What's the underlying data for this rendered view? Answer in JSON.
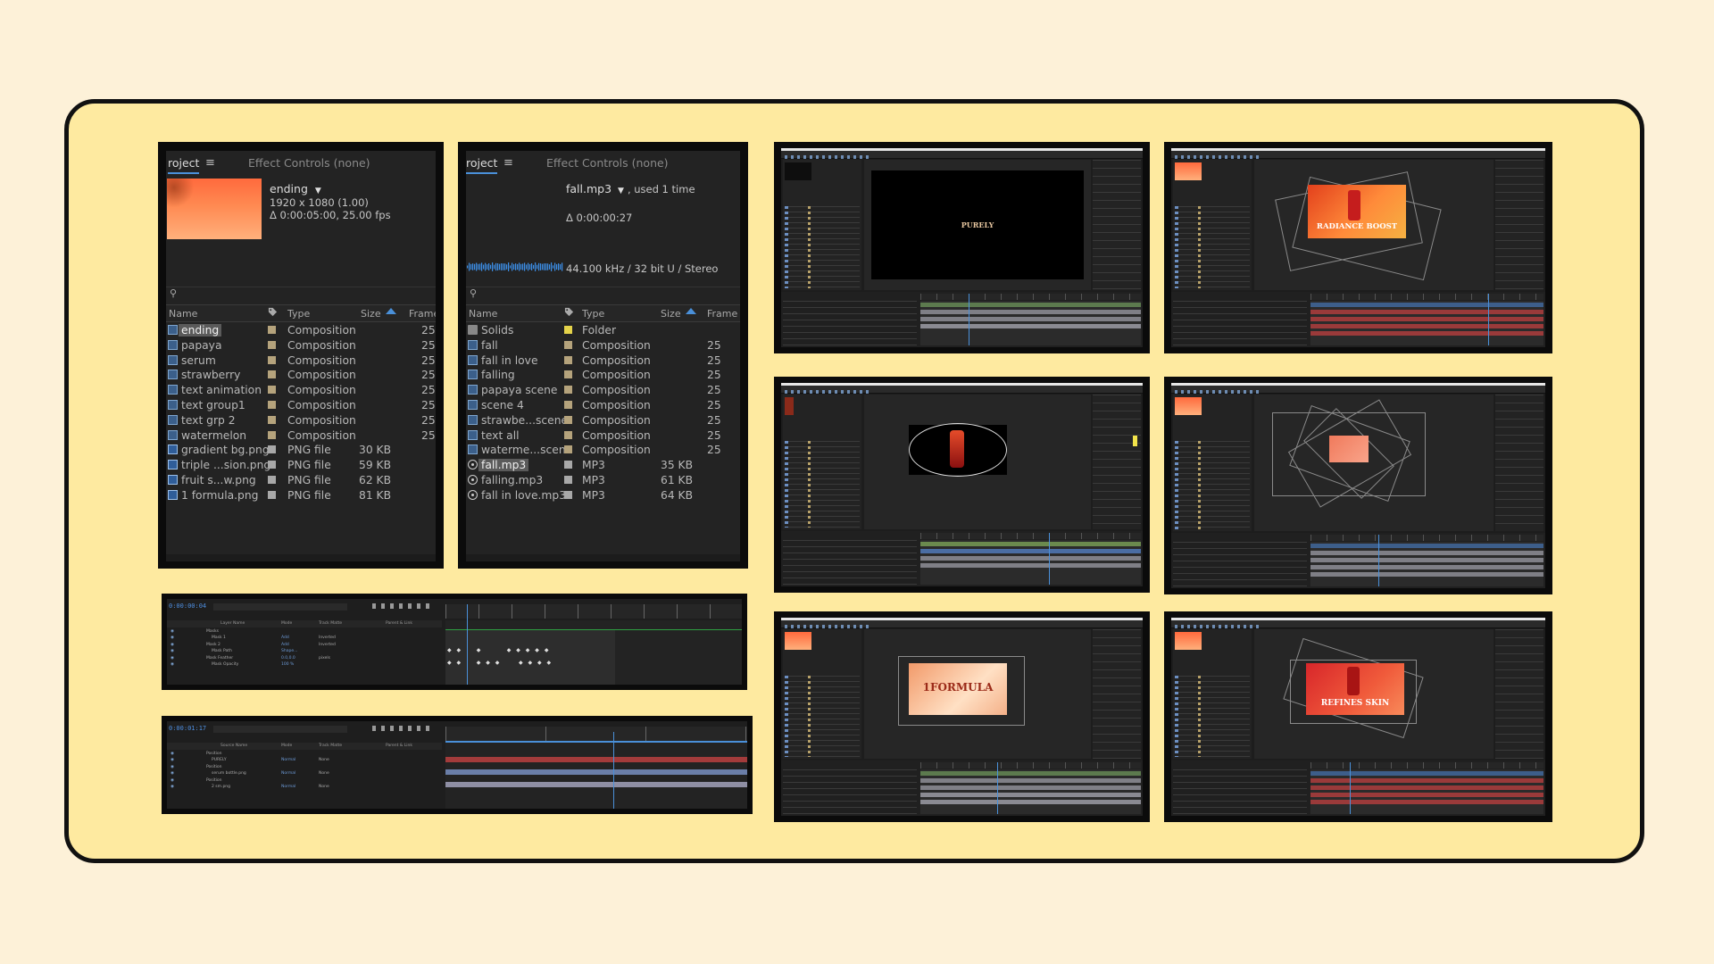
{
  "colors": {
    "background": "#fdf1d8",
    "board": "#feeaa0",
    "accent": "#4a90d9",
    "panel": "#232323"
  },
  "project1": {
    "tab_project": "roject",
    "tab_effect": "Effect Controls (none)",
    "selected_name": "ending",
    "resolution": "1920 x 1080 (1.00)",
    "duration": "Δ 0:00:05:00, 25.00 fps",
    "columns": {
      "name": "Name",
      "type": "Type",
      "size": "Size",
      "frame": "Frame"
    },
    "rows": [
      {
        "name": "ending",
        "type": "Composition",
        "size": "",
        "frame": "25"
      },
      {
        "name": "papaya",
        "type": "Composition",
        "size": "",
        "frame": "25"
      },
      {
        "name": "serum",
        "type": "Composition",
        "size": "",
        "frame": "25"
      },
      {
        "name": "strawberry",
        "type": "Composition",
        "size": "",
        "frame": "25"
      },
      {
        "name": "text animation",
        "type": "Composition",
        "size": "",
        "frame": "25"
      },
      {
        "name": "text group1",
        "type": "Composition",
        "size": "",
        "frame": "25"
      },
      {
        "name": "text grp 2",
        "type": "Composition",
        "size": "",
        "frame": "25"
      },
      {
        "name": "watermelon",
        "type": "Composition",
        "size": "",
        "frame": "25"
      },
      {
        "name": "gradient bg.png",
        "type": "PNG file",
        "size": "30 KB",
        "frame": ""
      },
      {
        "name": "triple ...sion.png",
        "type": "PNG file",
        "size": "59 KB",
        "frame": ""
      },
      {
        "name": "fruit s...w.png",
        "type": "PNG file",
        "size": "62 KB",
        "frame": ""
      },
      {
        "name": "1 formula.png",
        "type": "PNG file",
        "size": "81 KB",
        "frame": ""
      }
    ]
  },
  "project2": {
    "tab_project": "roject",
    "tab_effect": "Effect Controls (none)",
    "selected_name": "fall.mp3",
    "used": ", used 1 time",
    "duration": "Δ 0:00:00:27",
    "audio_info": "44.100 kHz / 32 bit U / Stereo",
    "columns": {
      "name": "Name",
      "type": "Type",
      "size": "Size",
      "frame": "Frame R"
    },
    "rows": [
      {
        "name": "Solids",
        "type": "Folder",
        "size": "",
        "frame": ""
      },
      {
        "name": "fall",
        "type": "Composition",
        "size": "",
        "frame": "25"
      },
      {
        "name": "fall in love",
        "type": "Composition",
        "size": "",
        "frame": "25"
      },
      {
        "name": "falling",
        "type": "Composition",
        "size": "",
        "frame": "25"
      },
      {
        "name": "papaya scene",
        "type": "Composition",
        "size": "",
        "frame": "25"
      },
      {
        "name": "scene 4",
        "type": "Composition",
        "size": "",
        "frame": "25"
      },
      {
        "name": "strawbe...scene",
        "type": "Composition",
        "size": "",
        "frame": "25"
      },
      {
        "name": "text all",
        "type": "Composition",
        "size": "",
        "frame": "25"
      },
      {
        "name": "waterme...scene",
        "type": "Composition",
        "size": "",
        "frame": "25"
      },
      {
        "name": "fall.mp3",
        "type": "MP3",
        "size": "35 KB",
        "frame": ""
      },
      {
        "name": "falling.mp3",
        "type": "MP3",
        "size": "61 KB",
        "frame": ""
      },
      {
        "name": "fall in love.mp3",
        "type": "MP3",
        "size": "64 KB",
        "frame": ""
      }
    ]
  },
  "timeline1": {
    "timecode": "0:00:00:04",
    "header": {
      "layer_name": "Layer Name",
      "mode": "Mode",
      "track_matte": "Track Matte",
      "parent": "Parent & Link"
    },
    "lines": [
      {
        "name": "Masks",
        "mode": "",
        "matte": ""
      },
      {
        "name": "Mask 1",
        "mode": "Add",
        "matte": "Inverted"
      },
      {
        "name": "Mask 2",
        "mode": "Add",
        "matte": "Inverted"
      },
      {
        "name": "Mask Path",
        "mode": "Shape...",
        "matte": ""
      },
      {
        "name": "Mask Feather",
        "mode": "0.0,0.0",
        "matte": "pixels"
      },
      {
        "name": "Mask Opacity",
        "mode": "100 %",
        "matte": ""
      }
    ]
  },
  "timeline2": {
    "timecode": "0:00:01:17",
    "header": {
      "layer_name": "Source Name",
      "mode": "Mode",
      "track_matte": "Track Matte",
      "parent": "Parent & Link"
    },
    "lines": [
      {
        "name": "Position",
        "mode": "",
        "matte": ""
      },
      {
        "name": "PURELY",
        "mode": "Normal",
        "matte": "None"
      },
      {
        "name": "Position",
        "mode": "",
        "matte": ""
      },
      {
        "name": "serum bottle.png",
        "mode": "Normal",
        "matte": "None"
      },
      {
        "name": "Position",
        "mode": "",
        "matte": ""
      },
      {
        "name": "2 sm.png",
        "mode": "Normal",
        "matte": "None"
      }
    ]
  },
  "screens": {
    "purely_label": "PURELY",
    "radiance_label": "RADIANCE BOOST",
    "formula_label": "1FORMULA",
    "refines_label": "REFINES SKIN"
  }
}
